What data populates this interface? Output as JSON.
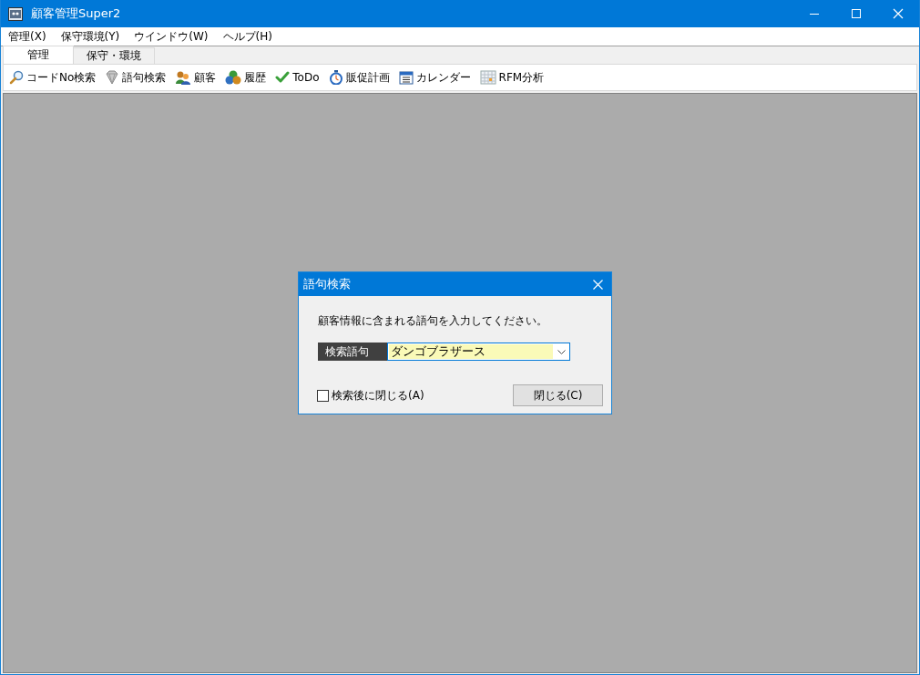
{
  "window": {
    "title": "顧客管理Super2"
  },
  "menu": [
    {
      "label": "管理(X)"
    },
    {
      "label": "保守環境(Y)"
    },
    {
      "label": "ウインドウ(W)"
    },
    {
      "label": "ヘルプ(H)"
    }
  ],
  "tabs": [
    {
      "label": "管理",
      "selected": true
    },
    {
      "label": "保守・環境",
      "selected": false
    }
  ],
  "toolbar": [
    {
      "label": "コードNo検索",
      "kind": "magnifier"
    },
    {
      "label": "語句検索",
      "kind": "gem"
    },
    {
      "label": "顧客",
      "kind": "people"
    },
    {
      "label": "履歴",
      "kind": "coins"
    },
    {
      "label": "ToDo",
      "kind": "check"
    },
    {
      "label": "販促計画",
      "kind": "stopwatch"
    },
    {
      "label": "カレンダー",
      "kind": "calendar"
    },
    {
      "label": "RFM分析",
      "kind": "grid"
    }
  ],
  "dialog": {
    "title": "語句検索",
    "message": "顧客情報に含まれる語句を入力してください。",
    "field": {
      "label": "検索語句",
      "value": "ダンゴブラザース"
    },
    "checkbox": {
      "label": "検索後に閉じる(A)",
      "checked": false
    },
    "button": "閉じる(C)"
  }
}
